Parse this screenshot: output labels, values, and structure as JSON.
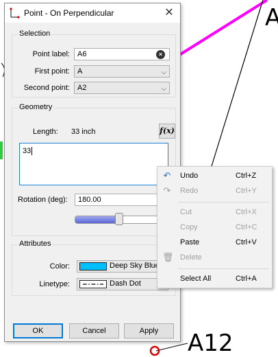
{
  "canvas": {
    "label_top": "A",
    "label_bottom": "A12",
    "magenta": "#ff00ff",
    "marker_red": "#e00000"
  },
  "dialog": {
    "title": "Point - On Perpendicular",
    "selection": {
      "group_title": "Selection",
      "point_label_label": "Point label:",
      "point_label_value": "A6",
      "first_point_label": "First point:",
      "first_point_value": "A",
      "second_point_label": "Second point:",
      "second_point_value": "A2"
    },
    "geometry": {
      "group_title": "Geometry",
      "length_label": "Length:",
      "length_value": "33 inch",
      "fx_label": "f(x)",
      "expression": "33",
      "rotation_label": "Rotation (deg):",
      "rotation_value": "180.00",
      "slider_fraction": 0.5
    },
    "attributes": {
      "group_title": "Attributes",
      "color_label": "Color:",
      "color_value": "Deep Sky Blue",
      "color_hex": "#00bfff",
      "linetype_label": "Linetype:",
      "linetype_value": "Dash Dot"
    },
    "buttons": {
      "ok": "OK",
      "cancel": "Cancel",
      "apply": "Apply"
    }
  },
  "context_menu": {
    "undo": {
      "label": "Undo",
      "shortcut": "Ctrl+Z"
    },
    "redo": {
      "label": "Redo",
      "shortcut": "Ctrl+Y"
    },
    "cut": {
      "label": "Cut",
      "shortcut": "Ctrl+X"
    },
    "copy": {
      "label": "Copy",
      "shortcut": "Ctrl+C"
    },
    "paste": {
      "label": "Paste",
      "shortcut": "Ctrl+V"
    },
    "delete": {
      "label": "Delete"
    },
    "select_all": {
      "label": "Select All",
      "shortcut": "Ctrl+A"
    }
  }
}
